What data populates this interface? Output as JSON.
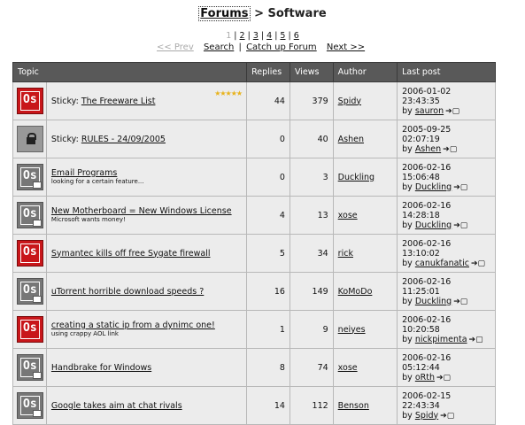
{
  "breadcrumb": {
    "forums": "Forums",
    "sep": ">",
    "current": "Software"
  },
  "pages": {
    "current": "1",
    "others": [
      "2",
      "3",
      "4",
      "5",
      "6"
    ]
  },
  "nav": {
    "prev": "<< Prev",
    "search": "Search",
    "sep": "|",
    "catchup": "Catch up Forum",
    "next": "Next >>"
  },
  "table": {
    "headers": {
      "topic": "Topic",
      "replies": "Replies",
      "views": "Views",
      "author": "Author",
      "last": "Last post"
    },
    "rows": [
      {
        "icon": "red",
        "prefix": "Sticky: ",
        "title": "The Freeware List",
        "desc": "",
        "stars": "★★★★★",
        "replies": "44",
        "views": "379",
        "author": "Spidy",
        "date": "2006-01-02 23:43:35",
        "by": "by",
        "lastuser": "sauron",
        "goto": "➔▢"
      },
      {
        "icon": "lock",
        "prefix": "Sticky: ",
        "title": "RULES - 24/09/2005",
        "desc": "",
        "stars": "",
        "replies": "0",
        "views": "40",
        "author": "Ashen",
        "date": "2005-09-25 02:07:19",
        "by": "by",
        "lastuser": "Ashen",
        "goto": "➔▢"
      },
      {
        "icon": "grey",
        "prefix": "",
        "title": "Email Programs",
        "desc": "looking for a certain feature...",
        "stars": "",
        "replies": "0",
        "views": "3",
        "author": "Duckling",
        "date": "2006-02-16 15:06:48",
        "by": "by",
        "lastuser": "Duckling",
        "goto": "➔▢"
      },
      {
        "icon": "grey",
        "prefix": "",
        "title": "New Motherboard = New Windows License",
        "desc": "Microsoft wants money!",
        "stars": "",
        "replies": "4",
        "views": "13",
        "author": "xose",
        "date": "2006-02-16 14:28:18",
        "by": "by",
        "lastuser": "Duckling",
        "goto": "➔▢"
      },
      {
        "icon": "red",
        "prefix": "",
        "title": "Symantec kills off free Sygate firewall",
        "desc": "",
        "stars": "",
        "replies": "5",
        "views": "34",
        "author": "rick",
        "date": "2006-02-16 13:10:02",
        "by": "by",
        "lastuser": "canukfanatic",
        "goto": "➔▢"
      },
      {
        "icon": "grey",
        "prefix": "",
        "title": "uTorrent horrible download speeds ?",
        "desc": "",
        "stars": "",
        "replies": "16",
        "views": "149",
        "author": "KoMoDo",
        "date": "2006-02-16 11:25:01",
        "by": "by",
        "lastuser": "Duckling",
        "goto": "➔▢"
      },
      {
        "icon": "red",
        "prefix": "",
        "title": "creating a static ip from a dynimc one!",
        "desc": "using crappy AOL link",
        "stars": "",
        "replies": "1",
        "views": "9",
        "author": "neiyes",
        "date": "2006-02-16 10:20:58",
        "by": "by",
        "lastuser": "nickpimenta",
        "goto": "➔▢"
      },
      {
        "icon": "grey",
        "prefix": "",
        "title": "Handbrake for Windows",
        "desc": "",
        "stars": "",
        "replies": "8",
        "views": "74",
        "author": "xose",
        "date": "2006-02-16 05:12:44",
        "by": "by",
        "lastuser": "oRth",
        "goto": "➔▢"
      },
      {
        "icon": "grey",
        "prefix": "",
        "title": "Google takes aim at chat rivals",
        "desc": "",
        "stars": "",
        "replies": "14",
        "views": "112",
        "author": "Benson",
        "date": "2006-02-15 22:43:34",
        "by": "by",
        "lastuser": "Spidy",
        "goto": "➔▢"
      }
    ]
  },
  "colors": {
    "header_bg": "#595959",
    "row_bg": "#ececec",
    "icon_red": "#c8161a",
    "icon_grey": "#777777",
    "stars": "#e8b21a"
  },
  "icons": {
    "red": "os-new-posts-icon",
    "grey": "os-no-new-posts-icon",
    "lock": "locked-topic-icon"
  }
}
